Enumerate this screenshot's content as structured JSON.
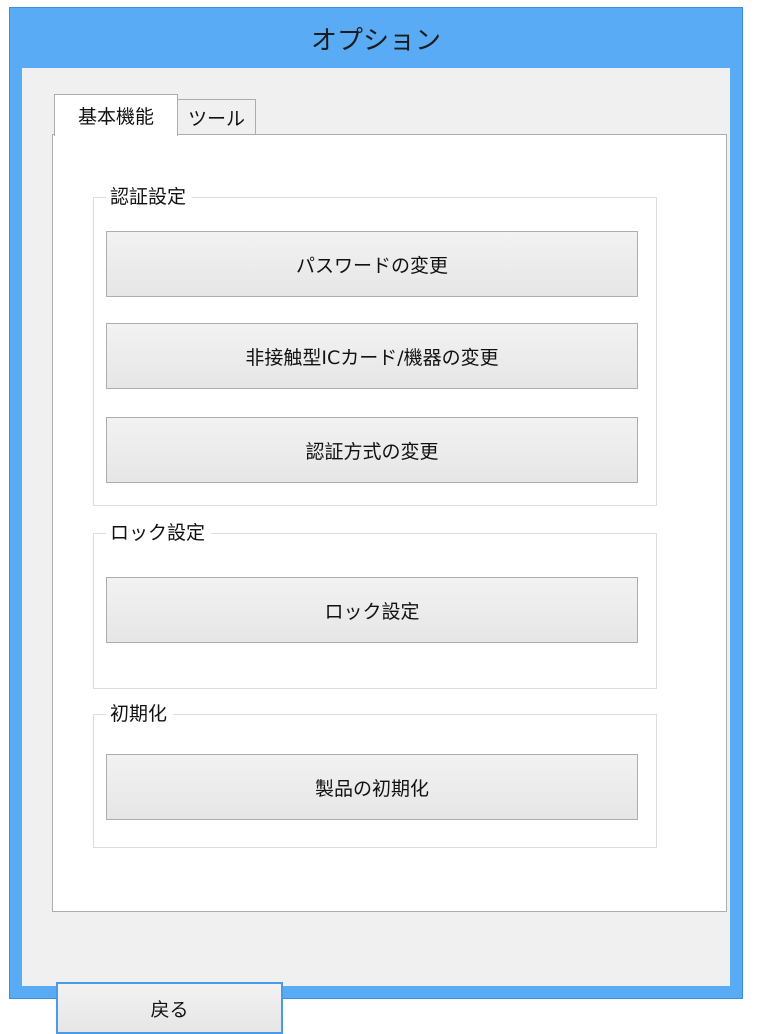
{
  "window": {
    "title": "オプション"
  },
  "tabs": [
    {
      "label": "基本機能",
      "active": true
    },
    {
      "label": "ツール",
      "active": false
    }
  ],
  "groups": {
    "auth": {
      "label": "認証設定",
      "buttons": [
        "パスワードの変更",
        "非接触型ICカード/機器の変更",
        "認証方式の変更"
      ]
    },
    "lock": {
      "label": "ロック設定",
      "buttons": [
        "ロック設定"
      ]
    },
    "init": {
      "label": "初期化",
      "buttons": [
        "製品の初期化"
      ]
    }
  },
  "footer": {
    "back_label": "戻る"
  },
  "colors": {
    "frame": "#59abf5",
    "client_bg": "#f0f0f0",
    "panel_bg": "#ffffff",
    "focus_border": "#4a9ae8"
  }
}
